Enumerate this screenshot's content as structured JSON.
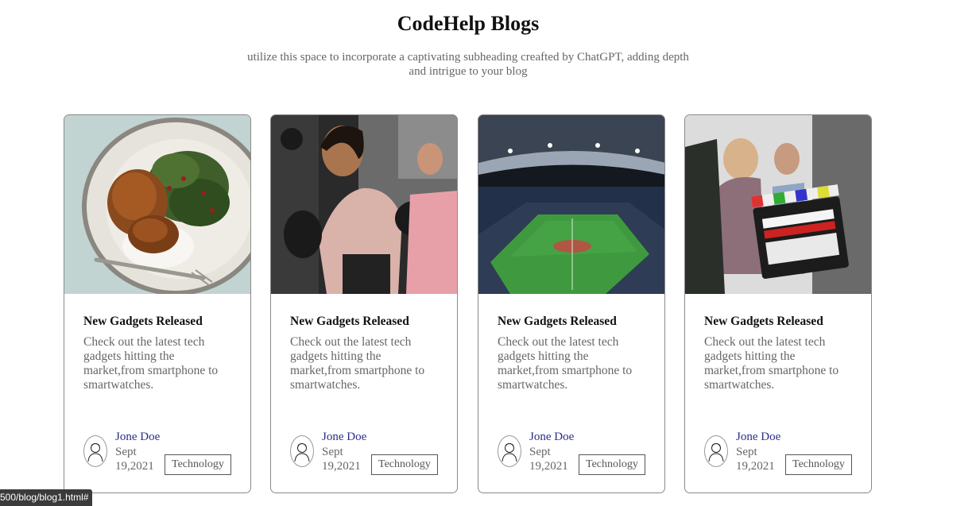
{
  "header": {
    "title": "CodeHelp Blogs",
    "subtitle": "utilize this space to incorporate a captivating subheading creafted by ChatGPT, adding depth and intrigue to your blog"
  },
  "cards": [
    {
      "image": "grilled-chicken-plate-photo",
      "title": "New Gadgets Released",
      "description": "Check out the latest tech gadgets hitting the market,from smartphone to smartwatches.",
      "author": "Jone Doe",
      "date": "Sept 19,2021",
      "tag": "Technology"
    },
    {
      "image": "women-boxing-photo",
      "title": "New Gadgets Released",
      "description": "Check out the latest tech gadgets hitting the market,from smartphone to smartwatches.",
      "author": "Jone Doe",
      "date": "Sept 19,2021",
      "tag": "Technology"
    },
    {
      "image": "football-stadium-photo",
      "title": "New Gadgets Released",
      "description": "Check out the latest tech gadgets hitting the market,from smartphone to smartwatches.",
      "author": "Jone Doe",
      "date": "Sept 19,2021",
      "tag": "Technology"
    },
    {
      "image": "film-clapperboard-photo",
      "title": "New Gadgets Released",
      "description": "Check out the latest tech gadgets hitting the market,from smartphone to smartwatches.",
      "author": "Jone Doe",
      "date": "Sept 19,2021",
      "tag": "Technology"
    }
  ],
  "status_bar": {
    "url": "500/blog/blog1.html#"
  }
}
